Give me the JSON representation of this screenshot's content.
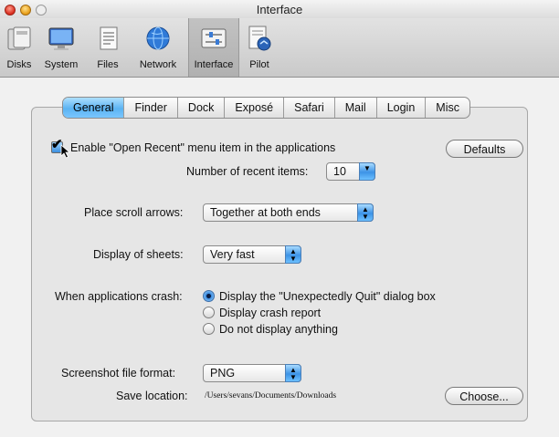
{
  "window": {
    "title": "Interface",
    "traffic_lights": {
      "close": "#e0443a",
      "minimize": "#f0b22a",
      "zoom": "#e8e8e8"
    }
  },
  "toolbar": {
    "items": [
      {
        "label": "Disks",
        "icon": "disk-icon"
      },
      {
        "label": "System",
        "icon": "monitor-icon"
      },
      {
        "label": "Files",
        "icon": "document-icon"
      },
      {
        "label": "Network",
        "icon": "globe-icon"
      },
      {
        "label": "Interface",
        "icon": "sliders-icon",
        "selected": true
      },
      {
        "label": "Pilot",
        "icon": "pilot-icon"
      }
    ]
  },
  "tabs": [
    {
      "label": "General",
      "active": true
    },
    {
      "label": "Finder"
    },
    {
      "label": "Dock"
    },
    {
      "label": "Exposé"
    },
    {
      "label": "Safari"
    },
    {
      "label": "Mail"
    },
    {
      "label": "Login"
    },
    {
      "label": "Misc"
    }
  ],
  "general": {
    "open_recent_label": "Enable \"Open Recent\" menu item in the applications",
    "open_recent_checked": true,
    "defaults_button": "Defaults",
    "recent_items_label": "Number of recent items:",
    "recent_items_value": "10",
    "scroll_arrows_label": "Place scroll arrows:",
    "scroll_arrows_value": "Together at both ends",
    "sheets_label": "Display of sheets:",
    "sheets_value": "Very fast",
    "crash_label": "When applications crash:",
    "crash_options": [
      {
        "label": "Display the \"Unexpectedly Quit\" dialog box",
        "selected": true
      },
      {
        "label": "Display crash report",
        "selected": false
      },
      {
        "label": "Do not display anything",
        "selected": false
      }
    ],
    "screenshot_format_label": "Screenshot file format:",
    "screenshot_format_value": "PNG",
    "save_location_label": "Save location:",
    "save_location_value": "/Users/sevans/Documents/Downloads",
    "choose_button": "Choose..."
  },
  "colors": {
    "accent": "#5bb3f2",
    "selected_tab": "#6cbcf7"
  }
}
